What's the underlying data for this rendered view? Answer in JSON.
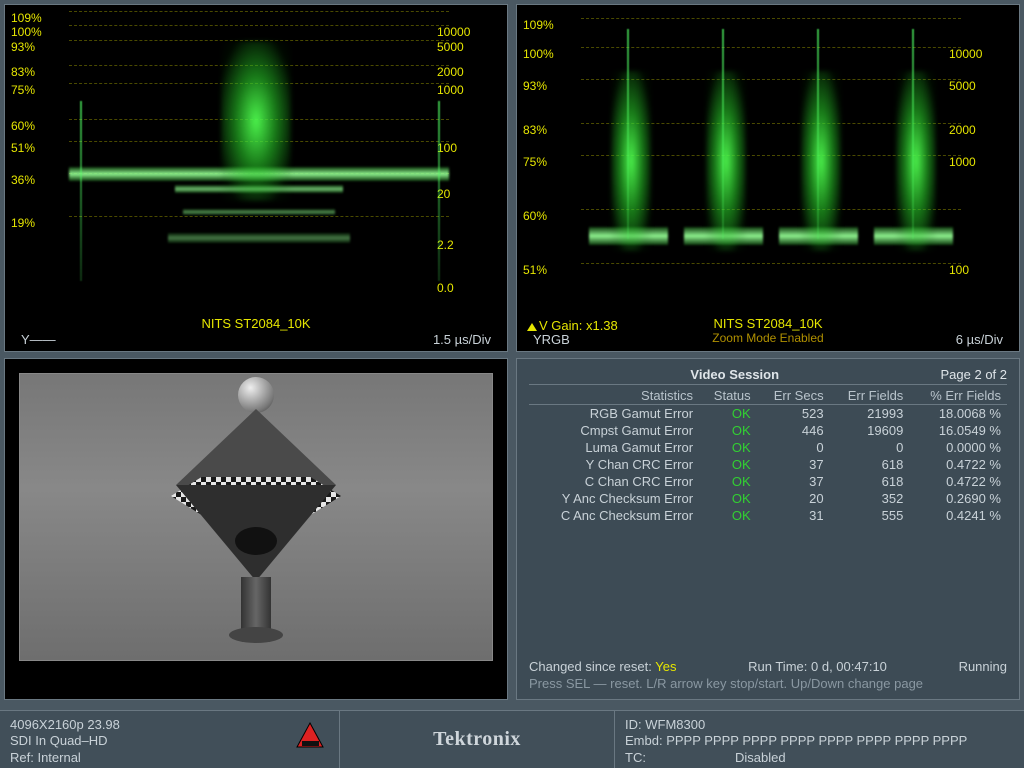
{
  "waveform_left": {
    "left_ticks": [
      "109%",
      "100%",
      "93%",
      "83%",
      "75%",
      "60%",
      "51%",
      "36%",
      "19%"
    ],
    "left_pos": [
      0,
      8,
      16,
      30,
      40,
      60,
      72,
      90,
      114
    ],
    "right_ticks": [
      "10000",
      "5000",
      "2000",
      "1000",
      "100",
      "20",
      "2.2",
      "0.0"
    ],
    "right_pos": [
      8,
      16,
      30,
      40,
      72,
      98,
      126,
      150
    ],
    "center_label": "NITS  ST2084_10K",
    "y_label": "Y——",
    "timebase": "1.5 µs/Div"
  },
  "waveform_right": {
    "left_ticks": [
      "109%",
      "100%",
      "93%",
      "83%",
      "75%",
      "60%",
      "51%"
    ],
    "left_pos": [
      4,
      20,
      38,
      62,
      80,
      110,
      140
    ],
    "right_ticks": [
      "10000",
      "5000",
      "2000",
      "1000",
      "100"
    ],
    "right_pos": [
      20,
      38,
      62,
      80,
      140
    ],
    "gain_label": "V Gain: x1.38",
    "center_label": "NITS  ST2084_10K",
    "zoom_label": "Zoom Mode Enabled",
    "y_label": "YRGB",
    "timebase": "6 µs/Div"
  },
  "stats": {
    "title": "Video Session",
    "page_label": "Page 2 of 2",
    "columns": [
      "Statistics",
      "Status",
      "Err Secs",
      "Err Fields",
      "% Err Fields"
    ],
    "rows": [
      {
        "name": "RGB Gamut Error",
        "status": "OK",
        "secs": "523",
        "fields": "21993",
        "pct": "18.0068 %"
      },
      {
        "name": "Cmpst Gamut Error",
        "status": "OK",
        "secs": "446",
        "fields": "19609",
        "pct": "16.0549 %"
      },
      {
        "name": "Luma Gamut Error",
        "status": "OK",
        "secs": "0",
        "fields": "0",
        "pct": "0.0000 %"
      },
      {
        "name": "Y Chan CRC Error",
        "status": "OK",
        "secs": "37",
        "fields": "618",
        "pct": "0.4722 %"
      },
      {
        "name": "C Chan CRC Error",
        "status": "OK",
        "secs": "37",
        "fields": "618",
        "pct": "0.4722 %"
      },
      {
        "name": "Y Anc Checksum Error",
        "status": "OK",
        "secs": "20",
        "fields": "352",
        "pct": "0.2690 %"
      },
      {
        "name": "C Anc Checksum Error",
        "status": "OK",
        "secs": "31",
        "fields": "555",
        "pct": "0.4241 %"
      }
    ],
    "changed_label": "Changed since reset:",
    "changed_value": "Yes",
    "runtime_label": "Run Time:",
    "runtime_value": "0 d, 00:47:10",
    "running_label": "Running",
    "hint": "Press SEL — reset. L/R arrow key stop/start. Up/Down change page"
  },
  "bottom": {
    "format": "4096X2160p 23.98",
    "input": "SDI In Quad–HD",
    "ref": "Ref: Internal",
    "brand": "Tektronix",
    "id_label": "ID:",
    "id_value": "WFM8300",
    "embd_label": "Embd:",
    "embd_value": "PPPP PPPP PPPP PPPP PPPP PPPP PPPP PPPP",
    "tc_label": "TC:",
    "tc_value": "Disabled"
  }
}
